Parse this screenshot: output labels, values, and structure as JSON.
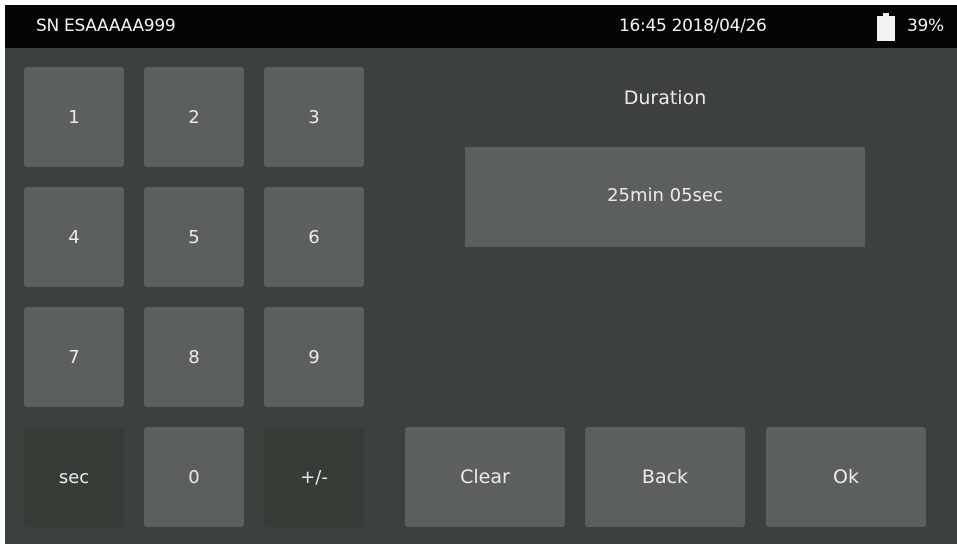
{
  "status_bar": {
    "serial": "SN ESAAAAA999",
    "datetime": "16:45 2018/04/26",
    "battery_icon": "battery-icon",
    "battery_percent": "39%"
  },
  "keypad": {
    "keys": [
      "1",
      "2",
      "3",
      "4",
      "5",
      "6",
      "7",
      "8",
      "9",
      "sec",
      "0",
      "+/-"
    ]
  },
  "field": {
    "label": "Duration",
    "value": "25min 05sec"
  },
  "actions": {
    "clear": "Clear",
    "back": "Back",
    "ok": "Ok"
  },
  "colors": {
    "background": "#3d413e",
    "status_bar": "#050505",
    "button": "#5c605d",
    "special_button": "#363d36",
    "text": "#eaeaea"
  }
}
